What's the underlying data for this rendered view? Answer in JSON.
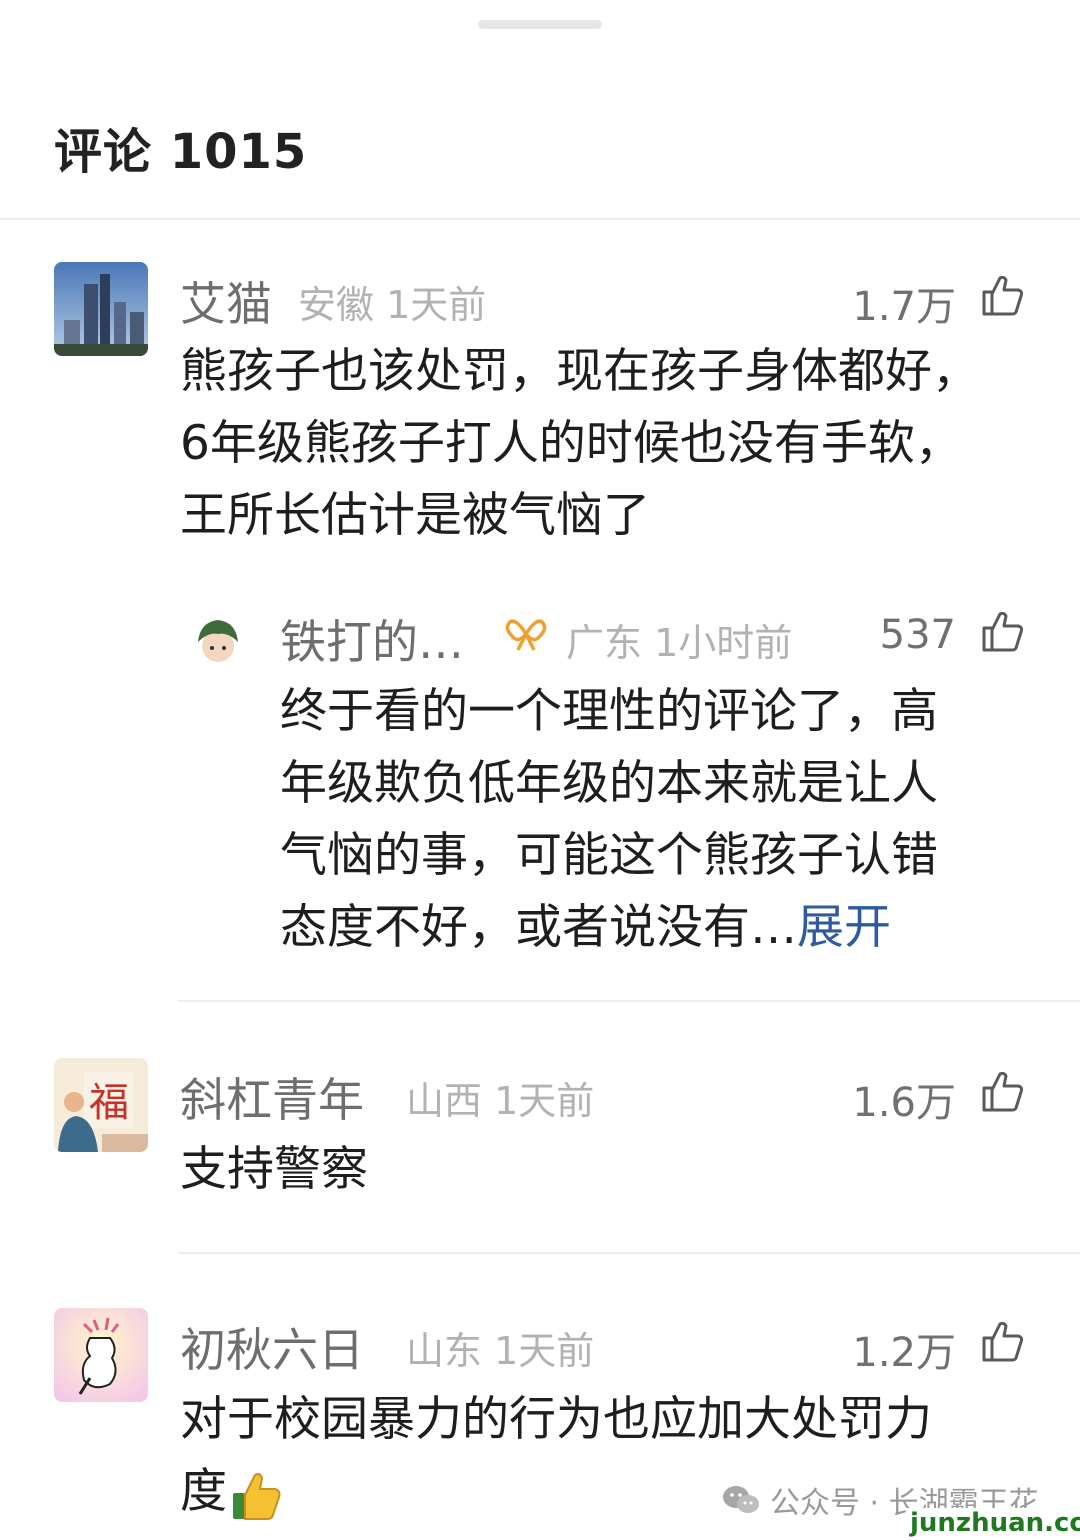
{
  "header": {
    "title": "评论 1015"
  },
  "comments": [
    {
      "name": "艾猫",
      "location": "安徽",
      "time": "1天前",
      "likes": "1.7万",
      "lines": [
        "熊孩子也该处罚，现在孩子身体都好，",
        "6年级熊孩子打人的时候也没有手软，",
        "王所长估计是被气恼了"
      ],
      "reply": {
        "name": "铁打的…",
        "location": "广东",
        "time": "1小时前",
        "likes": "537",
        "lines": [
          "终于看的一个理性的评论了，高",
          "年级欺负低年级的本来就是让人",
          "气恼的事，可能这个熊孩子认错"
        ],
        "last_line": "态度不好，或者说没有…",
        "expand_label": "展开"
      }
    },
    {
      "name": "斜杠青年",
      "location": "山西",
      "time": "1天前",
      "likes": "1.6万",
      "lines": [
        "支持警察"
      ],
      "avatar_char": "福"
    },
    {
      "name": "初秋六日",
      "location": "山东",
      "time": "1天前",
      "likes": "1.2万",
      "lines": [
        "对于校园暴力的行为也应加大处罚力"
      ],
      "last_line": "度"
    }
  ],
  "watermark": {
    "text": "公众号 · 长湖霸王花",
    "site": "junzhuan.com"
  },
  "icons": {
    "like": "thumbs-up-outline-icon",
    "verified": "ribbon-badge-icon",
    "wechat": "wechat-icon",
    "emoji": "thumbs-up-emoji-icon"
  },
  "colors": {
    "link": "#2f5b9e",
    "meta": "#b2b2b2",
    "verified": "#f0a030"
  }
}
